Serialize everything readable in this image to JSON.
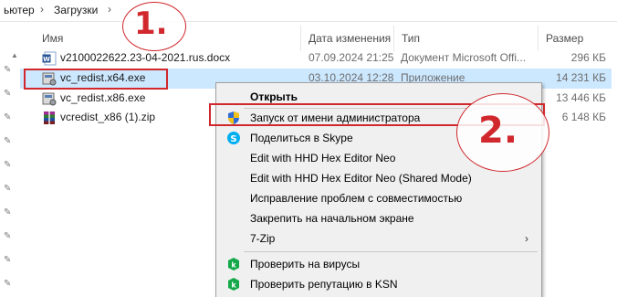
{
  "breadcrumb": {
    "items": [
      "ьютер",
      "Загрузки"
    ]
  },
  "columns": {
    "name": "Имя",
    "date": "Дата изменения",
    "type": "Тип",
    "size": "Размер"
  },
  "files": [
    {
      "name": "v2100022622.23-04-2021.rus.docx",
      "date": "07.09.2024 21:25",
      "type": "Документ Microsoft Offi...",
      "size": "296 КБ",
      "icon": "word-doc-icon"
    },
    {
      "name": "vc_redist.x64.exe",
      "date": "03.10.2024 12:28",
      "type": "Приложение",
      "size": "14 231 КБ",
      "icon": "installer-exe-icon"
    },
    {
      "name": "vc_redist.x86.exe",
      "date": "",
      "type": "",
      "size": "13 446 КБ",
      "icon": "installer-exe-icon"
    },
    {
      "name": "vcredist_x86 (1).zip",
      "date": "",
      "type": "",
      "size": "6 148 КБ",
      "icon": "zip-archive-icon"
    }
  ],
  "context_menu": {
    "items": [
      {
        "label": "Открыть",
        "bold": true,
        "icon": ""
      },
      {
        "label": "Запуск от имени администратора",
        "bold": false,
        "icon": "uac-shield-icon"
      },
      {
        "label": "Поделиться в Skype",
        "bold": false,
        "icon": "skype-icon"
      },
      {
        "label": "Edit with HHD Hex Editor Neo",
        "bold": false,
        "icon": ""
      },
      {
        "label": "Edit with HHD Hex Editor Neo (Shared Mode)",
        "bold": false,
        "icon": ""
      },
      {
        "label": "Исправление проблем с совместимостью",
        "bold": false,
        "icon": ""
      },
      {
        "label": "Закрепить на начальном экране",
        "bold": false,
        "icon": ""
      },
      {
        "label": "7-Zip",
        "bold": false,
        "icon": "",
        "submenu": "›"
      },
      {
        "label": "Проверить на вирусы",
        "bold": false,
        "icon": "kaspersky-icon"
      },
      {
        "label": "Проверить репутацию в KSN",
        "bold": false,
        "icon": "kaspersky-icon"
      }
    ]
  },
  "annotations": {
    "step1": "1.",
    "step2": "2."
  },
  "colors": {
    "annotation": "#d0282d",
    "selection": "#cce8ff",
    "menu_bg": "#f0f0f0",
    "shield_blue": "#2f6bd6",
    "shield_yellow": "#f2c21a",
    "skype_blue": "#00aff0",
    "kaspersky_green": "#14a84a"
  }
}
